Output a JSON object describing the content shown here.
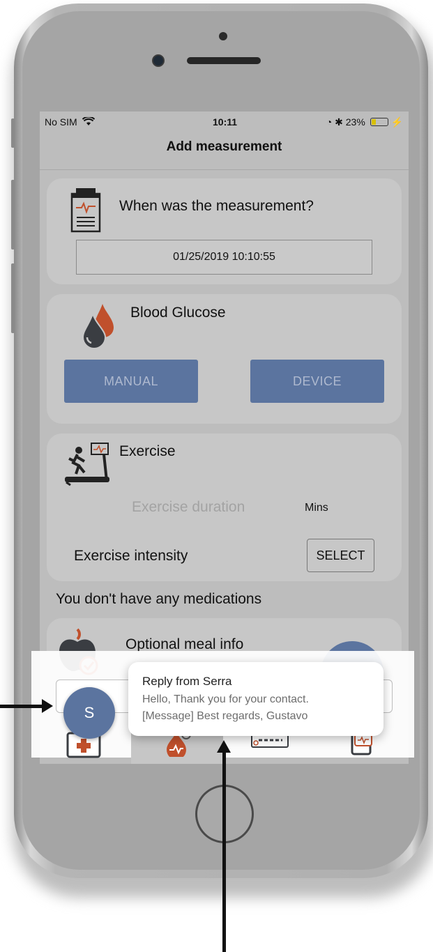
{
  "status_bar": {
    "carrier": "No SIM",
    "time": "10:11",
    "battery": "23%",
    "battery_level": 0.23
  },
  "header": {
    "title": "Add measurement"
  },
  "when_card": {
    "title": "When was the measurement?",
    "datetime": "01/25/2019 10:10:55",
    "icon": "clipboard-icon"
  },
  "glucose_card": {
    "title": "Blood Glucose",
    "manual_label": "MANUAL",
    "device_label": "DEVICE",
    "icon": "blood-drops-icon"
  },
  "exercise_card": {
    "title": "Exercise",
    "duration_placeholder": "Exercise duration",
    "duration_unit": "Mins",
    "intensity_label": "Exercise intensity",
    "select_label": "SELECT",
    "icon": "treadmill-icon"
  },
  "medications": {
    "empty_text": "You don't have any medications"
  },
  "meal_card": {
    "title": "Optional meal info",
    "icon": "apple-check-icon"
  },
  "notification": {
    "title": "Reply from Serra",
    "line1": "Hello, Thank you for your contact.",
    "line2": "[Message] Best regards, Gustavo",
    "avatar_initial": "S"
  },
  "tabs": [
    {
      "icon": "medical-kit-icon"
    },
    {
      "icon": "glucose-drop-icon"
    },
    {
      "icon": "log-book-icon"
    },
    {
      "icon": "phone-chat-icon"
    }
  ],
  "colors": {
    "accent": "#5b749f",
    "drop_red": "#c0502c",
    "drop_dark": "#3a3d42"
  }
}
